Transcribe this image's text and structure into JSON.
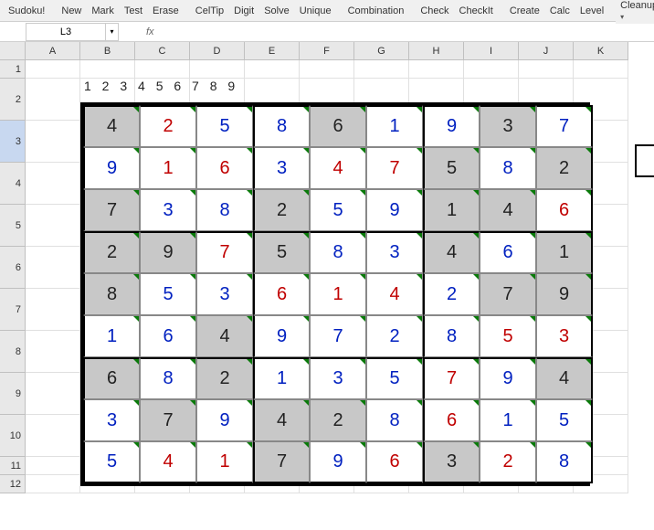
{
  "toolbar": {
    "items": [
      {
        "label": "Sudoku!",
        "sep": true
      },
      {
        "label": "New"
      },
      {
        "label": "Mark"
      },
      {
        "label": "Test"
      },
      {
        "label": "Erase",
        "sep": true
      },
      {
        "label": "CelTip"
      },
      {
        "label": "Digit"
      },
      {
        "label": "Solve"
      },
      {
        "label": "Unique",
        "sep": true
      },
      {
        "label": "Combination",
        "sep": true
      },
      {
        "label": "Check"
      },
      {
        "label": "CheckIt",
        "sep": true
      },
      {
        "label": "Create"
      },
      {
        "label": "Calc"
      },
      {
        "label": "Level",
        "sep": true
      },
      {
        "label": "Cleanup",
        "dropdown": true
      }
    ]
  },
  "namebox": {
    "ref": "L3",
    "fx_label": "fx"
  },
  "columns": [
    "A",
    "B",
    "C",
    "D",
    "E",
    "F",
    "G",
    "H",
    "I",
    "J",
    "K"
  ],
  "rows": [
    "1",
    "2",
    "3",
    "4",
    "5",
    "6",
    "7",
    "8",
    "9",
    "10",
    "11",
    "12"
  ],
  "selected_row": "3",
  "legend": "1 2 3 4 5 6 7 8 9",
  "sudoku": {
    "grid": [
      [
        {
          "v": "4",
          "t": "given"
        },
        {
          "v": "2",
          "t": "red"
        },
        {
          "v": "5",
          "t": "blue"
        },
        {
          "v": "8",
          "t": "blue"
        },
        {
          "v": "6",
          "t": "given"
        },
        {
          "v": "1",
          "t": "blue"
        },
        {
          "v": "9",
          "t": "blue"
        },
        {
          "v": "3",
          "t": "given"
        },
        {
          "v": "7",
          "t": "blue"
        }
      ],
      [
        {
          "v": "9",
          "t": "blue"
        },
        {
          "v": "1",
          "t": "red"
        },
        {
          "v": "6",
          "t": "red"
        },
        {
          "v": "3",
          "t": "blue"
        },
        {
          "v": "4",
          "t": "red"
        },
        {
          "v": "7",
          "t": "red"
        },
        {
          "v": "5",
          "t": "given"
        },
        {
          "v": "8",
          "t": "blue"
        },
        {
          "v": "2",
          "t": "given"
        }
      ],
      [
        {
          "v": "7",
          "t": "given"
        },
        {
          "v": "3",
          "t": "blue"
        },
        {
          "v": "8",
          "t": "blue"
        },
        {
          "v": "2",
          "t": "given"
        },
        {
          "v": "5",
          "t": "blue"
        },
        {
          "v": "9",
          "t": "blue"
        },
        {
          "v": "1",
          "t": "given"
        },
        {
          "v": "4",
          "t": "given"
        },
        {
          "v": "6",
          "t": "red"
        }
      ],
      [
        {
          "v": "2",
          "t": "given"
        },
        {
          "v": "9",
          "t": "given"
        },
        {
          "v": "7",
          "t": "red"
        },
        {
          "v": "5",
          "t": "given"
        },
        {
          "v": "8",
          "t": "blue"
        },
        {
          "v": "3",
          "t": "blue"
        },
        {
          "v": "4",
          "t": "given"
        },
        {
          "v": "6",
          "t": "blue"
        },
        {
          "v": "1",
          "t": "given"
        }
      ],
      [
        {
          "v": "8",
          "t": "given"
        },
        {
          "v": "5",
          "t": "blue"
        },
        {
          "v": "3",
          "t": "blue"
        },
        {
          "v": "6",
          "t": "red"
        },
        {
          "v": "1",
          "t": "red"
        },
        {
          "v": "4",
          "t": "red"
        },
        {
          "v": "2",
          "t": "blue"
        },
        {
          "v": "7",
          "t": "given"
        },
        {
          "v": "9",
          "t": "given"
        }
      ],
      [
        {
          "v": "1",
          "t": "blue"
        },
        {
          "v": "6",
          "t": "blue"
        },
        {
          "v": "4",
          "t": "given"
        },
        {
          "v": "9",
          "t": "blue"
        },
        {
          "v": "7",
          "t": "blue"
        },
        {
          "v": "2",
          "t": "blue"
        },
        {
          "v": "8",
          "t": "blue"
        },
        {
          "v": "5",
          "t": "red"
        },
        {
          "v": "3",
          "t": "red"
        }
      ],
      [
        {
          "v": "6",
          "t": "given"
        },
        {
          "v": "8",
          "t": "blue"
        },
        {
          "v": "2",
          "t": "given"
        },
        {
          "v": "1",
          "t": "blue"
        },
        {
          "v": "3",
          "t": "blue"
        },
        {
          "v": "5",
          "t": "blue"
        },
        {
          "v": "7",
          "t": "red"
        },
        {
          "v": "9",
          "t": "blue"
        },
        {
          "v": "4",
          "t": "given"
        }
      ],
      [
        {
          "v": "3",
          "t": "blue"
        },
        {
          "v": "7",
          "t": "given"
        },
        {
          "v": "9",
          "t": "blue"
        },
        {
          "v": "4",
          "t": "given"
        },
        {
          "v": "2",
          "t": "given"
        },
        {
          "v": "8",
          "t": "blue"
        },
        {
          "v": "6",
          "t": "red"
        },
        {
          "v": "1",
          "t": "blue"
        },
        {
          "v": "5",
          "t": "blue"
        }
      ],
      [
        {
          "v": "5",
          "t": "blue"
        },
        {
          "v": "4",
          "t": "red"
        },
        {
          "v": "1",
          "t": "red"
        },
        {
          "v": "7",
          "t": "given"
        },
        {
          "v": "9",
          "t": "blue"
        },
        {
          "v": "6",
          "t": "red"
        },
        {
          "v": "3",
          "t": "given"
        },
        {
          "v": "2",
          "t": "red"
        },
        {
          "v": "8",
          "t": "blue"
        }
      ]
    ]
  }
}
